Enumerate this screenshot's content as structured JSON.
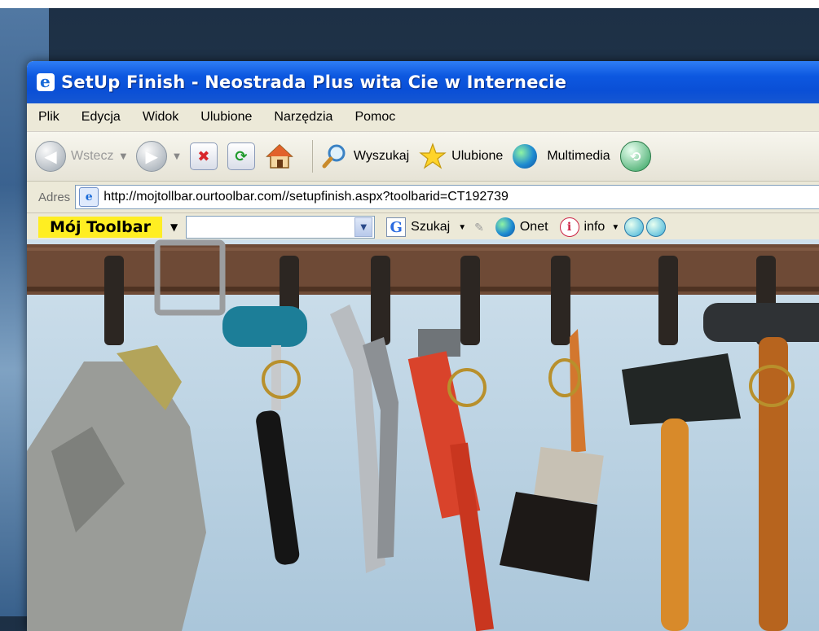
{
  "window": {
    "title": "SetUp Finish - Neostrada Plus wita Cie w Internecie"
  },
  "menu": [
    "Plik",
    "Edycja",
    "Widok",
    "Ulubione",
    "Narzędzia",
    "Pomoc"
  ],
  "toolbar": {
    "back_label": "Wstecz",
    "search_label": "Wyszukaj",
    "favorites_label": "Ulubione",
    "media_label": "Multimedia"
  },
  "address": {
    "label": "Adres",
    "url": "http://mojtollbar.ourtoolbar.com//setupfinish.aspx?toolbarid=CT192739"
  },
  "custom_toolbar": {
    "brand": "Mój Toolbar",
    "search_label": "Szukaj",
    "onet_label": "Onet",
    "info_label": "info"
  },
  "colors": {
    "titlebar": "#0a4fd6",
    "brand_bg": "#ffee22",
    "window_bg": "#ece9d8"
  },
  "icons": [
    "back-arrow-icon",
    "forward-arrow-icon",
    "stop-icon",
    "refresh-icon",
    "home-icon",
    "search-magnifier-icon",
    "favorites-star-icon",
    "media-globe-icon",
    "history-icon",
    "ie-page-icon",
    "google-g-icon",
    "onet-globe-icon",
    "info-icon",
    "play-icon",
    "stop-media-icon"
  ]
}
